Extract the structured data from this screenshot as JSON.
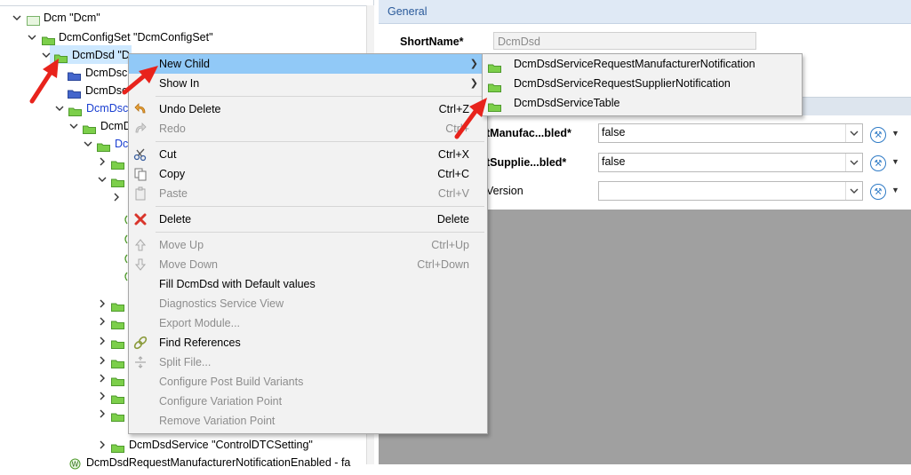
{
  "tree": {
    "root_label": "Dcm \"Dcm\"",
    "configset_label": "DcmConfigSet \"DcmConfigSet\"",
    "dcmdsd_label": "DcmDsd \"D",
    "child1_label": "DcmDsc",
    "child2_label": "DcmDsc",
    "child3_label": "DcmDsc",
    "child4_label": "DcmD",
    "child5_label": "Dc",
    "last_service_label": "DcmDsdService \"ControlDTCSetting\"",
    "bottom_param_label": "DcmDsdRequestManufacturerNotificationEnabled - fa"
  },
  "editor": {
    "general_title": "General",
    "shortname_label": "ShortName*",
    "shortname_value": "DcmDsd",
    "params": [
      {
        "label": "tManufac...bled*",
        "value": "false"
      },
      {
        "label": "tSupplie...bled*",
        "value": "false"
      },
      {
        "label": "Version",
        "value": ""
      }
    ]
  },
  "context_menu": {
    "items": [
      {
        "label": "New Child",
        "shortcut": "",
        "icon": "none",
        "disabled": false,
        "submenu": true,
        "highlighted": true
      },
      {
        "label": "Show In",
        "shortcut": "",
        "icon": "none",
        "disabled": false,
        "submenu": true
      },
      {
        "label": "Undo Delete",
        "shortcut": "Ctrl+Z",
        "icon": "undo-icon",
        "disabled": false
      },
      {
        "label": "Redo",
        "shortcut": "Ctrl+",
        "icon": "redo-icon",
        "disabled": true
      },
      {
        "label": "Cut",
        "shortcut": "Ctrl+X",
        "icon": "scissors-icon",
        "disabled": false
      },
      {
        "label": "Copy",
        "shortcut": "Ctrl+C",
        "icon": "copy-icon",
        "disabled": false
      },
      {
        "label": "Paste",
        "shortcut": "Ctrl+V",
        "icon": "paste-icon",
        "disabled": true
      },
      {
        "label": "Delete",
        "shortcut": "Delete",
        "icon": "delete-x-icon",
        "disabled": false
      },
      {
        "label": "Move Up",
        "shortcut": "Ctrl+Up",
        "icon": "arrow-up-icon",
        "disabled": true
      },
      {
        "label": "Move Down",
        "shortcut": "Ctrl+Down",
        "icon": "arrow-down-icon",
        "disabled": true
      },
      {
        "label": "Fill DcmDsd with Default values",
        "shortcut": "",
        "icon": "none",
        "disabled": false
      },
      {
        "label": "Diagnostics Service View",
        "shortcut": "",
        "icon": "none",
        "disabled": true
      },
      {
        "label": "Export Module...",
        "shortcut": "",
        "icon": "none",
        "disabled": true
      },
      {
        "label": "Find References",
        "shortcut": "",
        "icon": "link-icon",
        "disabled": false
      },
      {
        "label": "Split File...",
        "shortcut": "",
        "icon": "split-icon",
        "disabled": true
      },
      {
        "label": "Configure Post Build Variants",
        "shortcut": "",
        "icon": "none",
        "disabled": true
      },
      {
        "label": "Configure Variation Point",
        "shortcut": "",
        "icon": "none",
        "disabled": true
      },
      {
        "label": "Remove Variation Point",
        "shortcut": "",
        "icon": "none",
        "disabled": true
      }
    ]
  },
  "submenu": {
    "items": [
      {
        "label": "DcmDsdServiceRequestManufacturerNotification"
      },
      {
        "label": "DcmDsdServiceRequestSupplierNotification"
      },
      {
        "label": "DcmDsdServiceTable"
      }
    ]
  },
  "colors": {
    "folder_green": "#7ccf4a",
    "folder_blue": "#4466cc",
    "menu_highlight": "#91c9f7",
    "arrow_red": "#e8231c",
    "link_blue": "#1a3fd1"
  }
}
